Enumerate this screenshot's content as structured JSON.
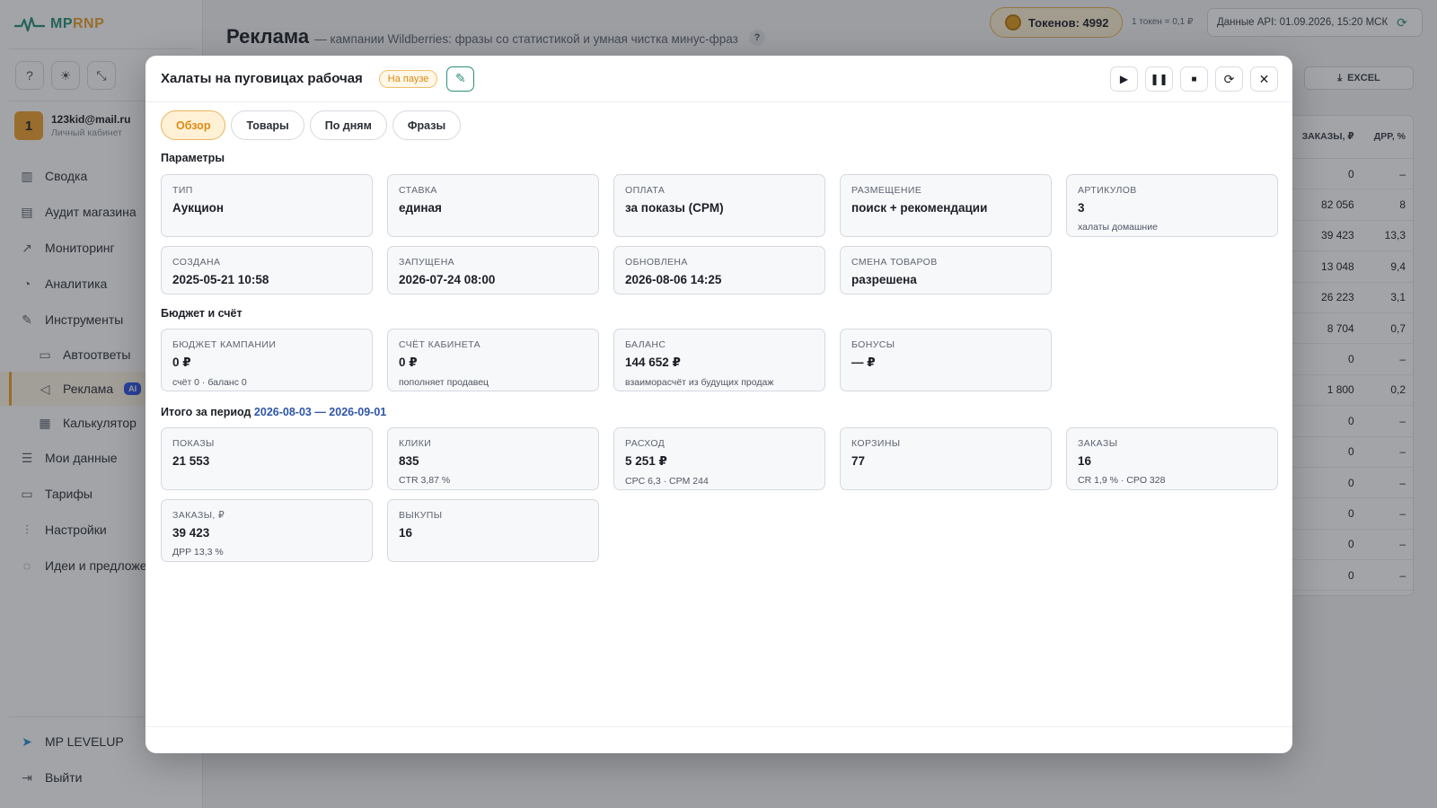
{
  "sidebar": {
    "logo_mp": "MP",
    "logo_rnp": "RNP",
    "user_badge": "1",
    "user_email": "123kid@mail.ru",
    "user_sub": "Личный кабинет",
    "nav": [
      {
        "label": "Сводка",
        "icon": "bar-chart-icon"
      },
      {
        "label": "Аудит магазина",
        "icon": "clipboard-icon"
      },
      {
        "label": "Мониторинг",
        "icon": "trend-icon"
      },
      {
        "label": "Аналитика",
        "icon": "pie-icon"
      },
      {
        "label": "Инструменты",
        "icon": "wrench-icon"
      },
      {
        "label": "Автоответы",
        "icon": "chat-icon"
      },
      {
        "label": "Реклама",
        "icon": "megaphone-icon",
        "badge": "AI"
      },
      {
        "label": "Калькулятор",
        "icon": "calculator-icon"
      },
      {
        "label": "Мои данные",
        "icon": "database-icon"
      },
      {
        "label": "Тарифы",
        "icon": "card-icon"
      },
      {
        "label": "Настройки",
        "icon": "sliders-icon"
      },
      {
        "label": "Идеи и предложе",
        "icon": "bulb-icon"
      }
    ],
    "bottom": [
      {
        "label": "MP LEVELUP",
        "icon": "telegram-icon"
      },
      {
        "label": "Выйти",
        "icon": "logout-icon"
      }
    ]
  },
  "header": {
    "title": "Реклама",
    "subtitle": "— кампании Wildberries: фразы со статистикой и умная чистка минус-фраз",
    "help": "?",
    "tokens_label": "Токенов: 4992",
    "token_rate": "1 токен = 0,1 ₽",
    "api_status": "Данные API: 01.09.2026, 15:20 МСК",
    "excel_label": "EXCEL"
  },
  "bg_table": {
    "headers": [
      "ЗАКАЗЫ, ₽",
      "ДРР, %"
    ],
    "rows": [
      [
        "0",
        "–"
      ],
      [
        "82 056",
        "8"
      ],
      [
        "39 423",
        "13,3"
      ],
      [
        "13 048",
        "9,4"
      ],
      [
        "26 223",
        "3,1"
      ],
      [
        "8 704",
        "0,7"
      ],
      [
        "0",
        "–"
      ],
      [
        "1 800",
        "0,2"
      ],
      [
        "0",
        "–"
      ],
      [
        "0",
        "–"
      ],
      [
        "0",
        "–"
      ],
      [
        "0",
        "–"
      ],
      [
        "0",
        "–"
      ],
      [
        "0",
        "–"
      ]
    ]
  },
  "modal": {
    "title": "Халаты на пуговицах рабочая",
    "status": "На паузе",
    "tabs": [
      "Обзор",
      "Товары",
      "По дням",
      "Фразы"
    ],
    "sections": {
      "params": "Параметры",
      "budget": "Бюджет и счёт",
      "period_prefix": "Итого за период",
      "period_range": "2026-08-03 — 2026-09-01"
    },
    "params": [
      {
        "label": "Тип",
        "value": "Аукцион",
        "sub": ""
      },
      {
        "label": "Ставка",
        "value": "единая",
        "sub": ""
      },
      {
        "label": "Оплата",
        "value": "за показы (CPM)",
        "sub": ""
      },
      {
        "label": "Размещение",
        "value": "поиск + рекомендации",
        "sub": ""
      },
      {
        "label": "Артикулов",
        "value": "3",
        "sub": "халаты домашние"
      },
      {
        "label": "Создана",
        "value": "2025-05-21 10:58",
        "sub": ""
      },
      {
        "label": "Запущена",
        "value": "2026-07-24 08:00",
        "sub": ""
      },
      {
        "label": "Обновлена",
        "value": "2026-08-06 14:25",
        "sub": ""
      },
      {
        "label": "Смена товаров",
        "value": "разрешена",
        "sub": ""
      }
    ],
    "budget": [
      {
        "label": "Бюджет кампании",
        "value": "0 ₽",
        "sub": "счёт 0 · баланс 0"
      },
      {
        "label": "Счёт кабинета",
        "value": "0 ₽",
        "sub": "пополняет продавец"
      },
      {
        "label": "Баланс",
        "value": "144 652 ₽",
        "sub": "взаиморасчёт из будущих продаж"
      },
      {
        "label": "Бонусы",
        "value": "— ₽",
        "sub": ""
      }
    ],
    "totals": [
      {
        "label": "Показы",
        "value": "21 553",
        "sub": ""
      },
      {
        "label": "Клики",
        "value": "835",
        "sub": "CTR 3,87 %"
      },
      {
        "label": "Расход",
        "value": "5 251 ₽",
        "sub": "CPC 6,3 · CPM 244"
      },
      {
        "label": "Корзины",
        "value": "77",
        "sub": ""
      },
      {
        "label": "Заказы",
        "value": "16",
        "sub": "CR 1,9 % · CPO 328"
      },
      {
        "label": "Заказы, ₽",
        "value": "39 423",
        "sub": "ДРР 13,3 %"
      },
      {
        "label": "Выкупы",
        "value": "16",
        "sub": ""
      }
    ]
  }
}
